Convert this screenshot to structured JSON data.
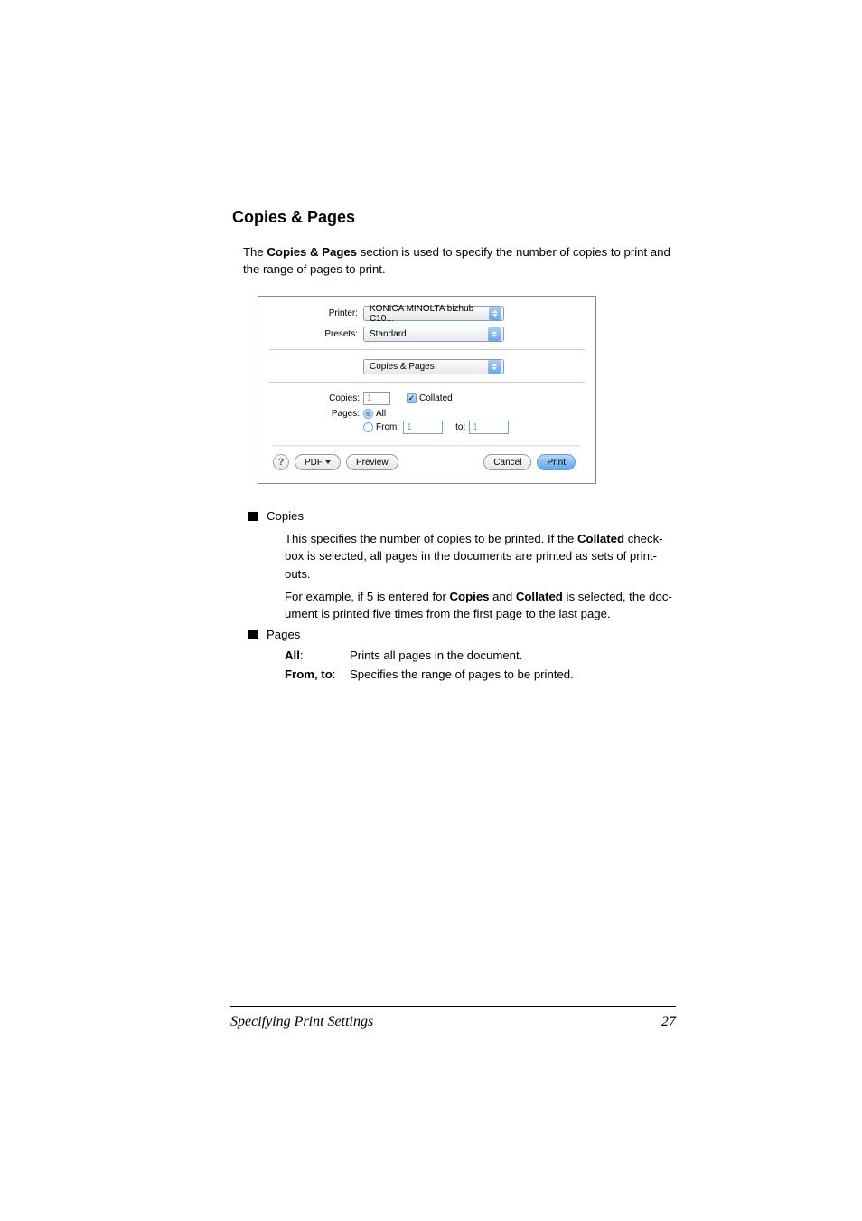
{
  "heading": "Copies & Pages",
  "intro_parts": {
    "p1": "The ",
    "b1": "Copies & Pages",
    "p2": " section is used to specify the number of copies to print and the range of pages to print."
  },
  "dialog": {
    "printer_label": "Printer:",
    "printer_value": "KONICA MINOLTA bizhub C10...",
    "presets_label": "Presets:",
    "presets_value": "Standard",
    "panel_value": "Copies & Pages",
    "copies_label": "Copies:",
    "copies_value": "1",
    "collated_label": "Collated",
    "pages_label": "Pages:",
    "all_label": "All",
    "from_label": "From:",
    "from_value": "1",
    "to_label": "to:",
    "to_value": "1",
    "help": "?",
    "pdf_label": "PDF",
    "preview_label": "Preview",
    "cancel_label": "Cancel",
    "print_label": "Print"
  },
  "bullets": {
    "copies_title": "Copies",
    "copies_desc_parts": {
      "p1": "This specifies the number of copies to be printed. If the ",
      "b1": "Collated",
      "p2": " check-box is selected, all pages in the documents are printed as sets of print-outs."
    },
    "copies_example_parts": {
      "p1": "For example, if 5 is entered for ",
      "b1": "Copies",
      "p2": " and ",
      "b2": "Collated",
      "p3": " is selected, the doc-ument is printed five times from the first page to the last page."
    },
    "pages_title": "Pages",
    "all_term": "All",
    "all_desc": "Prints all pages in the document.",
    "fromto_term": "From, to",
    "fromto_desc": "Specifies the range of pages to be printed."
  },
  "footer": {
    "title": "Specifying Print Settings",
    "page": "27"
  }
}
